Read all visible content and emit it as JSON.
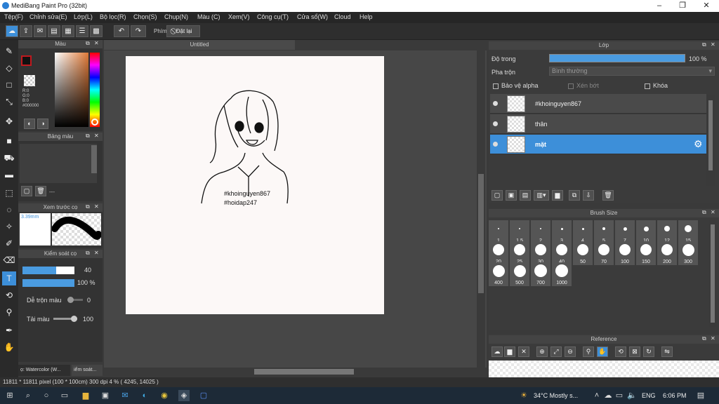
{
  "window": {
    "title": "MediBang Paint Pro (32bit)"
  },
  "menu": [
    "Tệp(F)",
    "Chỉnh sửa(E)",
    "Lớp(L)",
    "Bộ lọc(R)",
    "Chọn(S)",
    "Chụp(N)",
    "Màu (C)",
    "Xem(V)",
    "Công cụ(T)",
    "Cửa sổ(W)",
    "Cloud",
    "Help"
  ],
  "toolbar": {
    "keys_label": "Phím",
    "reset_label": "Đặt lại"
  },
  "color_panel": {
    "title": "Màu",
    "r": "R:0",
    "g": "G:0",
    "b": "B:0",
    "hex": "#000000"
  },
  "palette_panel": {
    "title": "Bảng màu",
    "dash": "---"
  },
  "brush_preview": {
    "title": "Xem trước cọ",
    "size": "3.39mm"
  },
  "brush_control": {
    "title": "Kiểm soát cọ",
    "size_value": "40",
    "opacity_value": "100 %",
    "blend_label": "Dễ trộn màu",
    "blend_value": "0",
    "reload_label": "Tải màu",
    "reload_value": "100"
  },
  "tool_tabs": {
    "tab1": "ọ: Watercolor (W...",
    "tab2": "iểm soát..."
  },
  "canvas": {
    "tab": "Untitled",
    "text1": "#khoinguyen867",
    "text2": "#hoidap247"
  },
  "layer_panel": {
    "title": "Lớp",
    "opacity_label": "Độ trong",
    "opacity_value": "100 %",
    "blend_label": "Pha trộn",
    "blend_value": "Bình thường",
    "protect_alpha": "Bảo vệ alpha",
    "clip": "Xén bớt",
    "lock": "Khóa",
    "layers": [
      {
        "name": "#khoinguyen867",
        "selected": false
      },
      {
        "name": "thân",
        "selected": false
      },
      {
        "name": "mặt",
        "selected": true
      }
    ]
  },
  "brush_size_panel": {
    "title": "Brush Size",
    "sizes": [
      "1",
      "1.5",
      "2",
      "3",
      "4",
      "5",
      "7",
      "10",
      "12",
      "15",
      "20",
      "25",
      "30",
      "40",
      "50",
      "70",
      "100",
      "150",
      "200",
      "300",
      "400",
      "500",
      "700",
      "1000"
    ]
  },
  "reference_panel": {
    "title": "Reference"
  },
  "status": {
    "text": "11811 * 11811 pixel  (100 * 100cm)  300 dpi  4 %  ( 4245, 14025 )"
  },
  "taskbar": {
    "weather": "34°C  Mostly s...",
    "lang": "ENG",
    "time": "6:06 PM"
  },
  "colors": {
    "accent": "#3d8fd9",
    "bg": "#3a3a3a",
    "panel_header": "#444444"
  }
}
